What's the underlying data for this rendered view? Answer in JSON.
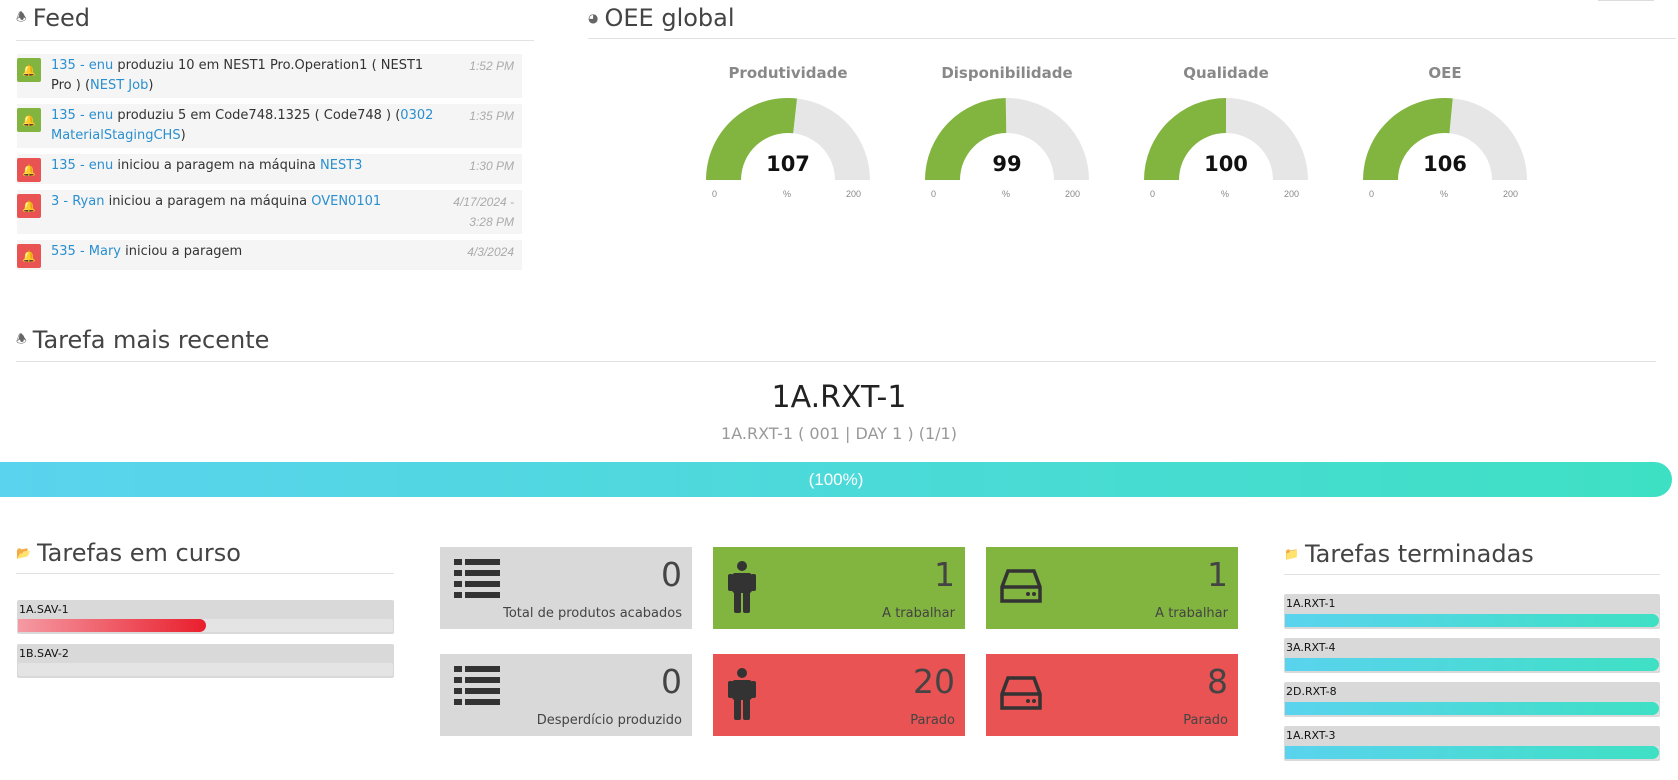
{
  "feed": {
    "title": "Feed",
    "icon": "bell-icon",
    "items": [
      {
        "type": "green",
        "who": "135 - enu",
        "text": " produziu 10 em NEST1 Pro.Operation1 ( NEST1 Pro ) (",
        "link": "NEST Job",
        "tail": ")",
        "time": "1:52 PM"
      },
      {
        "type": "green",
        "who": "135 - enu",
        "text": " produziu 5 em Code748.1325 ( Code748 ) (",
        "link": "0302 MaterialStagingCHS",
        "tail": ")",
        "time": "1:35 PM"
      },
      {
        "type": "red",
        "who": "135 - enu",
        "text": " iniciou a paragem na máquina ",
        "link": "NEST3",
        "tail": "",
        "time": "1:30 PM"
      },
      {
        "type": "red",
        "who": "3 - Ryan",
        "text": " iniciou a paragem na máquina ",
        "link": "OVEN0101",
        "tail": "",
        "time": "4/17/2024 - 3:28 PM"
      },
      {
        "type": "red",
        "who": "535 - Mary",
        "text": " iniciou a paragem",
        "link": "",
        "tail": "",
        "time": "4/3/2024"
      }
    ]
  },
  "oee": {
    "title": "OEE global",
    "icon": "dashboard-icon",
    "max": 200,
    "min": 0,
    "unit": "%",
    "gauges": [
      {
        "label": "Produtividade",
        "value": 107
      },
      {
        "label": "Disponibilidade",
        "value": 99
      },
      {
        "label": "Qualidade",
        "value": 100
      },
      {
        "label": "OEE",
        "value": 106
      }
    ],
    "color_fill": "#82b440",
    "color_track": "#e6e6e6"
  },
  "recent": {
    "title": "Tarefa mais recente",
    "icon": "bell-icon",
    "task": "1A.RXT-1",
    "subtitle": "1A.RXT-1 ( 001 | DAY 1 ) (1/1)",
    "progress_label": "(100%)",
    "progress": 100
  },
  "in_progress": {
    "title": "Tarefas em curso",
    "icon": "folder-open-icon",
    "items": [
      {
        "label": "1A.SAV-1",
        "progress": 0.5
      },
      {
        "label": "1B.SAV-2",
        "progress": 0
      }
    ]
  },
  "tiles": [
    {
      "value": "0",
      "caption": "Total de produtos acabados",
      "color": "grey",
      "icon": "list-icon"
    },
    {
      "value": "1",
      "caption": "A trabalhar",
      "color": "green",
      "icon": "person-icon"
    },
    {
      "value": "1",
      "caption": "A trabalhar",
      "color": "green",
      "icon": "hard-drive-icon"
    },
    {
      "value": "0",
      "caption": "Desperdício produzido",
      "color": "grey",
      "icon": "list-icon"
    },
    {
      "value": "20",
      "caption": "Parado",
      "color": "red",
      "icon": "person-icon"
    },
    {
      "value": "8",
      "caption": "Parado",
      "color": "red",
      "icon": "hard-drive-icon"
    }
  ],
  "done": {
    "title": "Tarefas terminadas",
    "icon": "folder-icon",
    "items": [
      {
        "label": "1A.RXT-1",
        "progress": 1
      },
      {
        "label": "3A.RXT-4",
        "progress": 1
      },
      {
        "label": "2D.RXT-8",
        "progress": 1
      },
      {
        "label": "1A.RXT-3",
        "progress": 1
      }
    ]
  }
}
